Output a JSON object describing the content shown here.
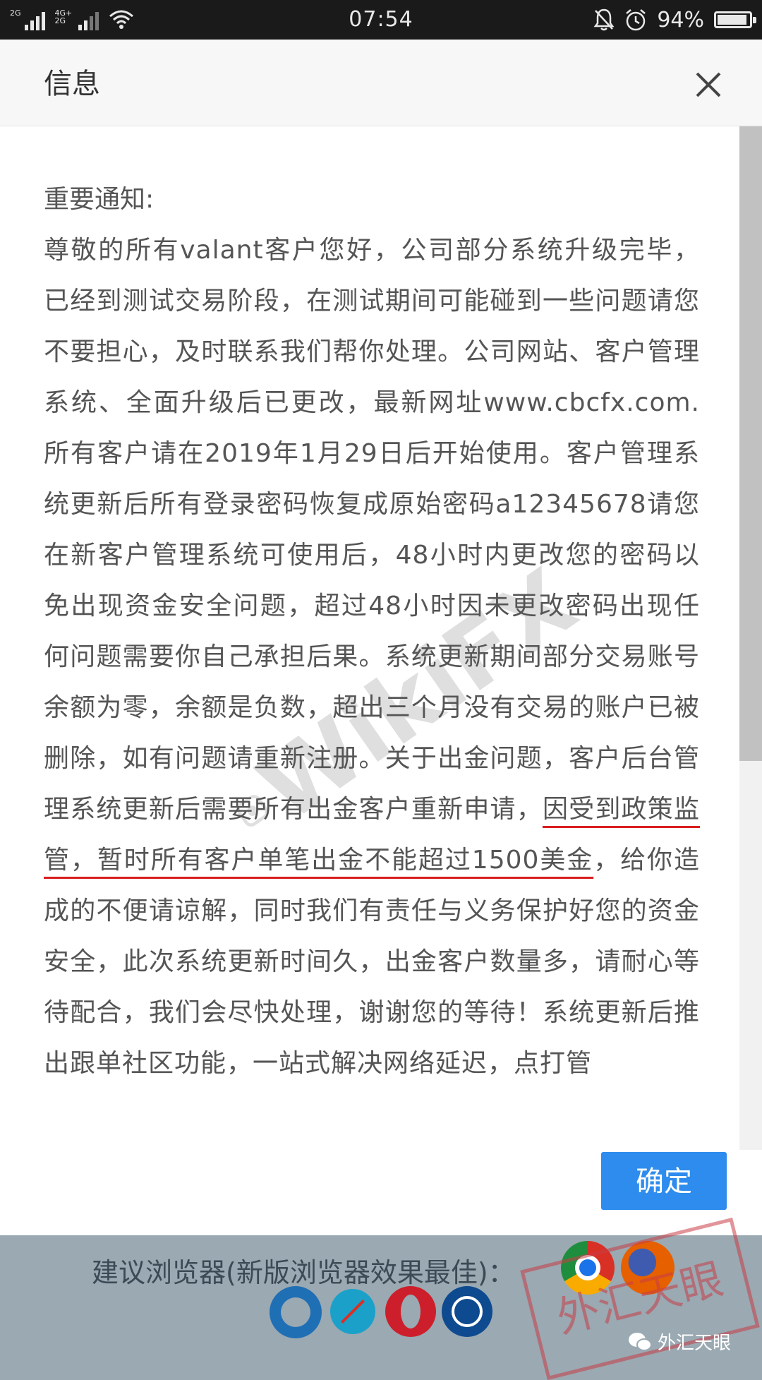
{
  "status_bar": {
    "sim1_label": "2G",
    "sim2_label": "4G+ 2G",
    "time": "07:54",
    "battery_percent": "94%",
    "battery_level": 0.94
  },
  "dialog": {
    "title": "信息",
    "heading": "重要通知:",
    "body_before": "尊敬的所有valant客户您好，公司部分系统升级完毕，已经到测试交易阶段，在测试期间可能碰到一些问题请您不要担心，及时联系我们帮你处理。公司网站、客户管理系统、全面升级后已更改，最新网址www.cbcfx.com.所有客户请在2019年1月29日后开始使用。客户管理系统更新后所有登录密码恢复成原始密码a12345678请您在新客户管理系统可使用后，48小时内更改您的密码以免出现资金安全问题，超过48小时因未更改密码出现任何问题需要你自己承担后果。系统更新期间部分交易账号余额为零，余额是负数，超出三个月没有交易的账户已被删除，如有问题请重新注册。关于出金问题，客户后台管理系统更新后需要所有出金客户重新申请，",
    "body_highlight": "因受到政策监管，暂时所有客户单笔出金不能超过1500美金",
    "body_after": "，给你造成的不便请谅解，同时我们有责任与义务保护好您的资金安全，此次系统更新时间久，出金客户数量多，请耐心等待配合，我们会尽快处理，谢谢您的等待！系统更新后推出跟单社区功能，一站式解决网络延迟，点打管",
    "scroll_position": 0.0,
    "scroll_visible_fraction": 0.62,
    "confirm_label": "确定",
    "accent_color": "#2d8ced",
    "highlight_color": "#d81e1e"
  },
  "background_page": {
    "browsers_label": "建议浏览器(新版浏览器效果最佳)："
  },
  "icons": {
    "close": "close-icon",
    "alarm": "alarm-icon",
    "mute": "mute-bell-icon",
    "wifi": "wifi-icon",
    "wechat": "wechat-icon"
  },
  "watermarks": {
    "wikifx": "WikiFX",
    "stamp": "外汇天眼",
    "wechat_account": "外汇天眼"
  }
}
